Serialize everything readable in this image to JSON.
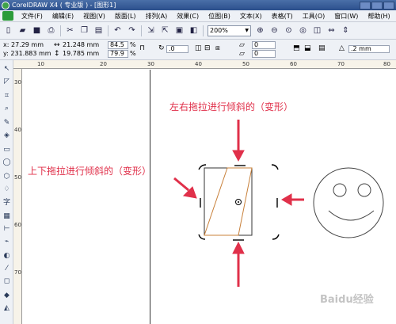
{
  "window": {
    "title": "CorelDRAW X4 ( 专业版 ) - [图形1]"
  },
  "menu": [
    "文件(F)",
    "编辑(E)",
    "视图(V)",
    "版面(L)",
    "排列(A)",
    "效果(C)",
    "位图(B)",
    "文本(X)",
    "表格(T)",
    "工具(O)",
    "窗口(W)",
    "帮助(H)"
  ],
  "toolbar": {
    "zoom": "200%"
  },
  "properties": {
    "x": "x:  27.29 mm",
    "y": "y:  231.883 mm",
    "width": "21.248 mm",
    "height": "19.785 mm",
    "scale_x": "84.5",
    "scale_y": "79.9",
    "pct": "%",
    "rotation": ".0",
    "skew_h": "0",
    "skew_v": "0",
    "outline": ".2 mm"
  },
  "ruler": {
    "h_ticks": [
      "10",
      "20",
      "30",
      "40",
      "50",
      "60",
      "70",
      "80"
    ],
    "v_ticks": [
      "30",
      "40",
      "50",
      "60",
      "70"
    ]
  },
  "annotations": {
    "top": "左右拖拉进行倾斜的（变形）",
    "left": "上下拖拉进行倾斜的（变形）"
  },
  "watermark": "Baidu经验",
  "colors": {
    "annotation": "#e0304a",
    "shape_outline": "#c8803a"
  }
}
